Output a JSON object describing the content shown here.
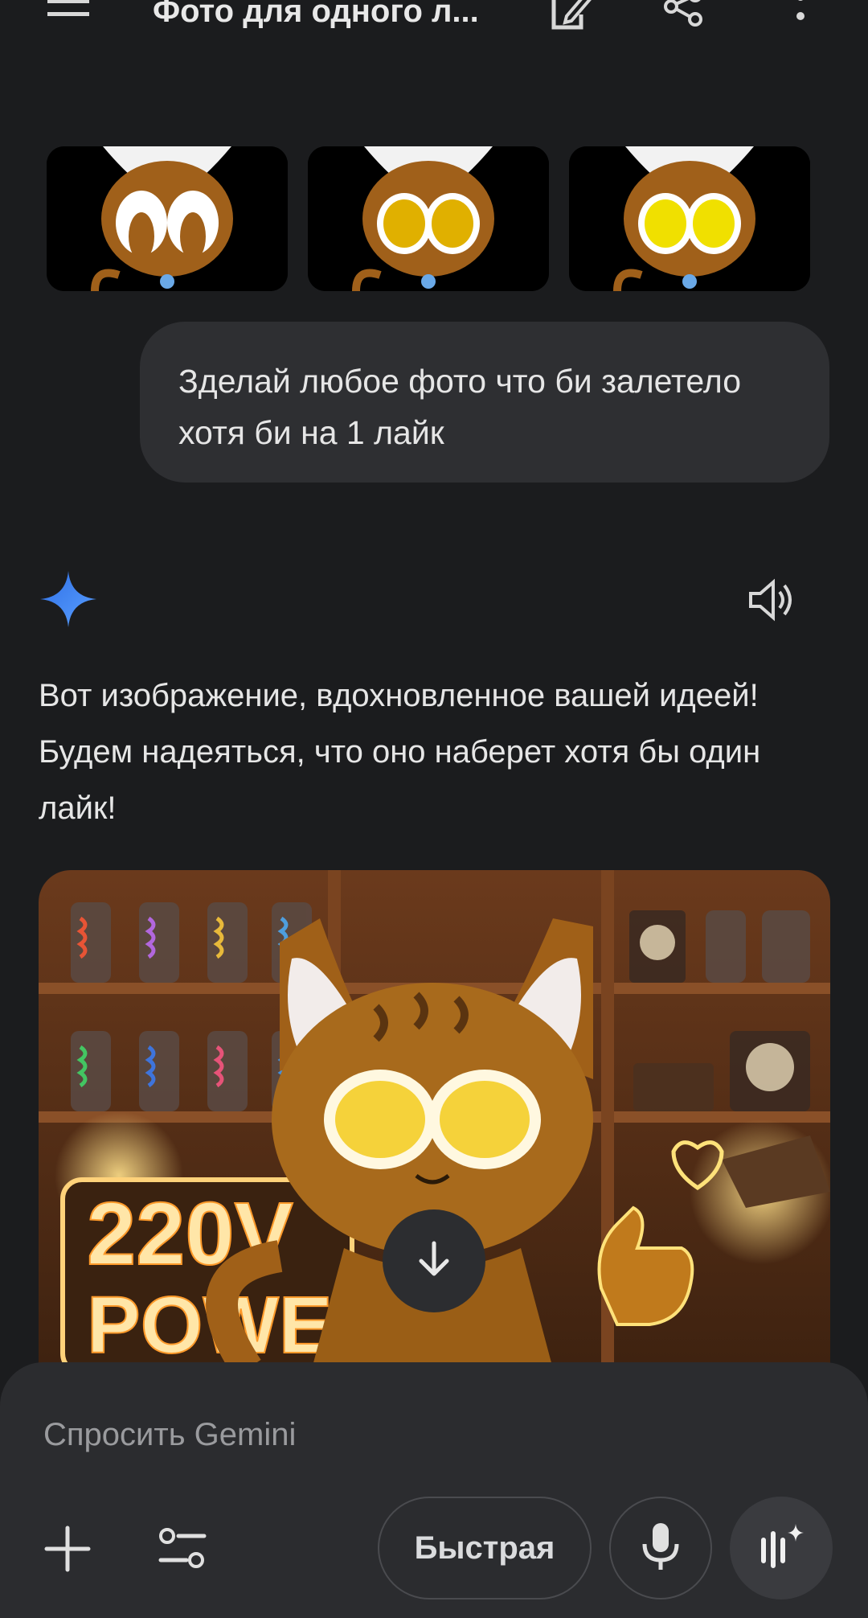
{
  "topbar": {
    "menu_icon": "menu-icon",
    "title": "Фото для одного л...",
    "edit_icon": "edit-icon",
    "share_icon": "share-icon",
    "more_icon": "more-vert-icon"
  },
  "user_message": {
    "attachments": [
      "cat-image-1",
      "cat-image-2",
      "cat-image-3"
    ],
    "text": "Зделай любое фото что би залетело хотя би на 1 лайк"
  },
  "response": {
    "logo_icon": "gemini-sparkle-icon",
    "speaker_icon": "speaker-icon",
    "text": "Вот изображение, вдохновленное вашей идеей! Будем надеяться, что оно наберет хотя бы один лайк!",
    "image_sign_line1": "220V",
    "image_sign_line2": "POWER",
    "download_icon": "download-icon"
  },
  "input": {
    "placeholder": "Спросить Gemini",
    "add_icon": "plus-icon",
    "tools_icon": "tools-icon",
    "mode_label": "Быстрая",
    "mic_icon": "mic-icon",
    "live_icon": "live-icon"
  },
  "colors": {
    "background": "#1b1c1e",
    "bubble": "#2e2f32",
    "panel": "#2b2c2f",
    "gemini_blue": "#4a8cff"
  }
}
